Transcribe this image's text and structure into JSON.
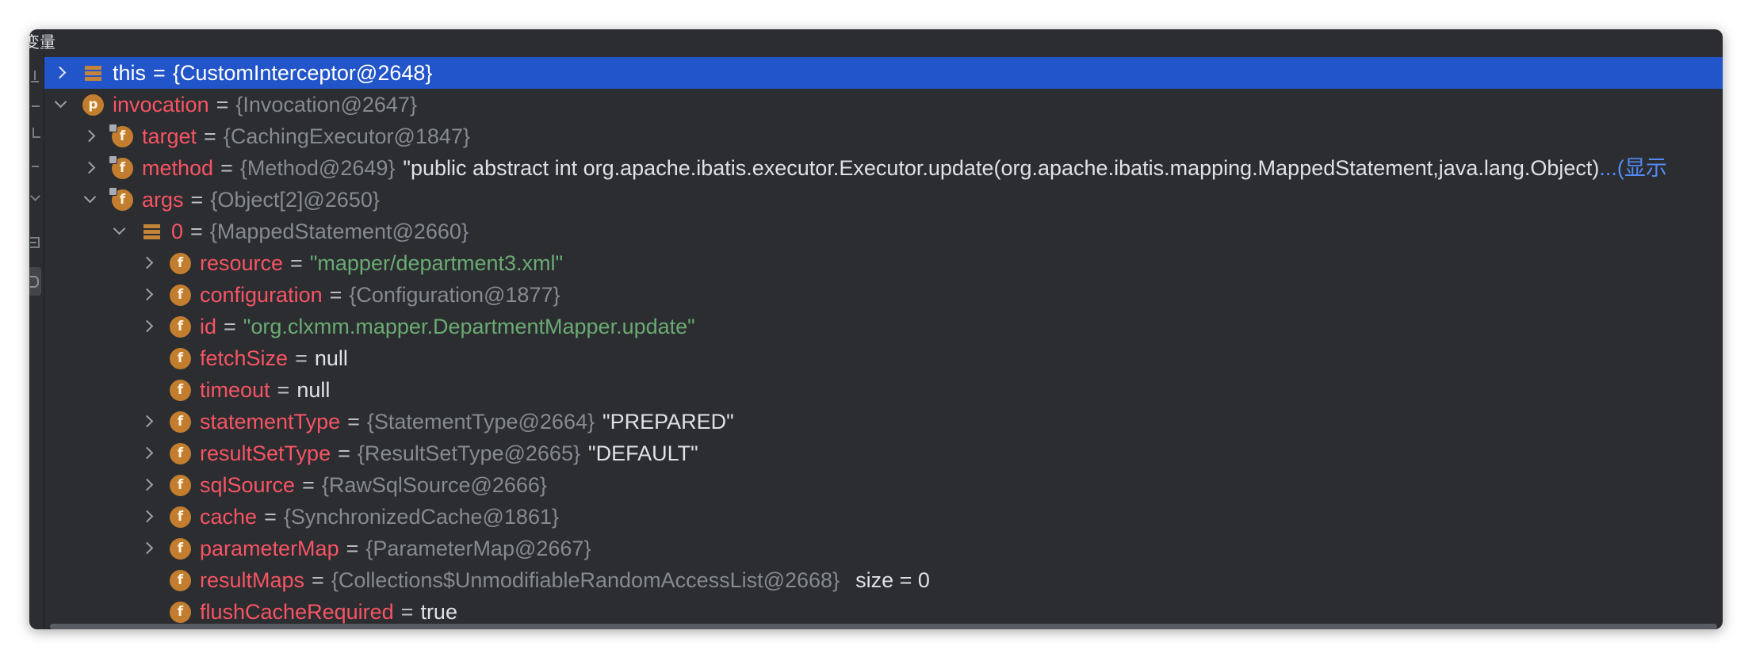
{
  "panel": {
    "title": "变量"
  },
  "toolbar": {
    "icons": [
      "add-watch-icon",
      "remove-watch-icon",
      "move-up-icon",
      "move-down-icon",
      "duplicate-icon",
      "table-view-icon",
      "show-watches-icon"
    ],
    "active": "show-watches-icon"
  },
  "colors": {
    "panel_background": "#2b2d30",
    "selection": "#2255c9",
    "variable_name": "#f75464",
    "type_info": "#868a91",
    "string_value": "#6aab73",
    "plain_value": "#dfe1e5",
    "link": "#548af7",
    "field_icon": "#c27d2e"
  },
  "variables": {
    "separator": "=",
    "rows": [
      {
        "name": "this",
        "type": "{CustomInterceptor@2648}",
        "toggle": "chevron-right-icon",
        "icon": "object-icon",
        "selected": true
      },
      {
        "name": "invocation",
        "type": "{Invocation@2647}",
        "toggle": "chevron-down-icon",
        "icon": "parameter-icon"
      },
      {
        "name": "target",
        "type": "{CachingExecutor@1847}",
        "toggle": "chevron-right-icon",
        "icon": "final-field-icon"
      },
      {
        "name": "method",
        "type": "{Method@2649}",
        "value": "\"public abstract int org.apache.ibatis.executor.Executor.update(org.apache.ibatis.mapping.MappedStatement,java.lang.Object)",
        "link": "...(显示",
        "toggle": "chevron-right-icon",
        "icon": "final-field-icon"
      },
      {
        "name": "args",
        "type": "{Object[2]@2650}",
        "toggle": "chevron-down-icon",
        "icon": "final-field-icon"
      },
      {
        "name": "0",
        "type": "{MappedStatement@2660}",
        "toggle": "chevron-down-icon",
        "icon": "object-icon"
      },
      {
        "name": "resource",
        "string": "\"mapper/department3.xml\"",
        "toggle": "chevron-right-icon",
        "icon": "field-icon"
      },
      {
        "name": "configuration",
        "type": "{Configuration@1877}",
        "toggle": "chevron-right-icon",
        "icon": "field-icon"
      },
      {
        "name": "id",
        "string": "\"org.clxmm.mapper.DepartmentMapper.update\"",
        "toggle": "chevron-right-icon",
        "icon": "field-icon"
      },
      {
        "name": "fetchSize",
        "value": "null",
        "icon": "field-icon"
      },
      {
        "name": "timeout",
        "value": "null",
        "icon": "field-icon"
      },
      {
        "name": "statementType",
        "type": "{StatementType@2664}",
        "value": "\"PREPARED\"",
        "toggle": "chevron-right-icon",
        "icon": "field-icon"
      },
      {
        "name": "resultSetType",
        "type": "{ResultSetType@2665}",
        "value": "\"DEFAULT\"",
        "toggle": "chevron-right-icon",
        "icon": "field-icon"
      },
      {
        "name": "sqlSource",
        "type": "{RawSqlSource@2666}",
        "toggle": "chevron-right-icon",
        "icon": "field-icon"
      },
      {
        "name": "cache",
        "type": "{SynchronizedCache@1861}",
        "toggle": "chevron-right-icon",
        "icon": "field-icon"
      },
      {
        "name": "parameterMap",
        "type": "{ParameterMap@2667}",
        "toggle": "chevron-right-icon",
        "icon": "field-icon"
      },
      {
        "name": "resultMaps",
        "type": "{Collections$UnmodifiableRandomAccessList@2668}",
        "value": "size = 0",
        "icon": "field-icon"
      },
      {
        "name": "flushCacheRequired",
        "value": "true",
        "icon": "field-icon"
      }
    ]
  }
}
